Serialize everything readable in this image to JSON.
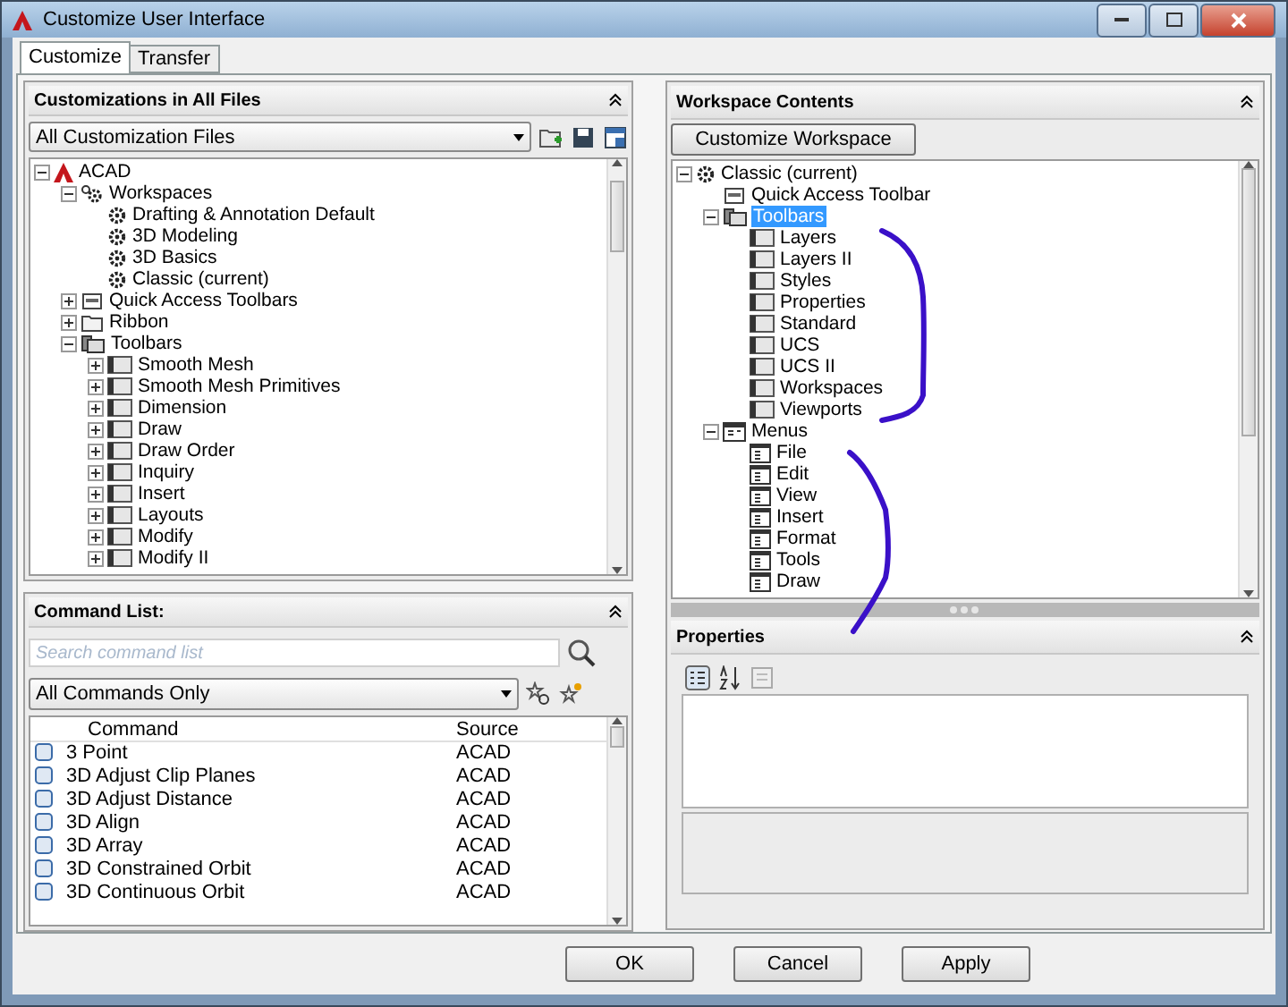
{
  "window": {
    "title": "Customize User Interface"
  },
  "tabs": [
    {
      "label": "Customize",
      "selected": true
    },
    {
      "label": "Transfer",
      "selected": false
    }
  ],
  "customizations": {
    "title": "Customizations in All Files",
    "file_filter": "All Customization Files",
    "tree": [
      {
        "label": "ACAD",
        "kind": "acad",
        "expanded": true,
        "selected": false,
        "children": [
          {
            "label": "Workspaces",
            "kind": "workspaces",
            "expanded": true,
            "selected": false,
            "children": [
              {
                "label": "Drafting & Annotation Default",
                "kind": "workspace",
                "selected": false
              },
              {
                "label": "3D Modeling",
                "kind": "workspace",
                "selected": false
              },
              {
                "label": "3D Basics",
                "kind": "workspace",
                "selected": false
              },
              {
                "label": "Classic (current)",
                "kind": "workspace",
                "selected": false
              }
            ]
          },
          {
            "label": "Quick Access Toolbars",
            "kind": "qat",
            "expanded": false,
            "selected": false
          },
          {
            "label": "Ribbon",
            "kind": "ribbon",
            "expanded": false,
            "selected": false
          },
          {
            "label": "Toolbars",
            "kind": "toolbars",
            "expanded": true,
            "selected": false,
            "children": [
              {
                "label": "Smooth Mesh",
                "kind": "toolbar",
                "expanded": false,
                "selected": false
              },
              {
                "label": "Smooth Mesh Primitives",
                "kind": "toolbar",
                "expanded": false,
                "selected": false
              },
              {
                "label": "Dimension",
                "kind": "toolbar",
                "expanded": false,
                "selected": false
              },
              {
                "label": "Draw",
                "kind": "toolbar",
                "expanded": false,
                "selected": false
              },
              {
                "label": "Draw Order",
                "kind": "toolbar",
                "expanded": false,
                "selected": false
              },
              {
                "label": "Inquiry",
                "kind": "toolbar",
                "expanded": false,
                "selected": false
              },
              {
                "label": "Insert",
                "kind": "toolbar",
                "expanded": false,
                "selected": false
              },
              {
                "label": "Layouts",
                "kind": "toolbar",
                "expanded": false,
                "selected": false
              },
              {
                "label": "Modify",
                "kind": "toolbar",
                "expanded": false,
                "selected": false
              },
              {
                "label": "Modify II",
                "kind": "toolbar",
                "expanded": false,
                "selected": false
              }
            ]
          }
        ]
      }
    ]
  },
  "command_list": {
    "title": "Command List:",
    "search": {
      "placeholder": "Search command list"
    },
    "filter": "All Commands Only",
    "columns": [
      "Command",
      "Source"
    ],
    "rows": [
      {
        "command": "3 Point",
        "source": "ACAD"
      },
      {
        "command": "3D Adjust Clip Planes",
        "source": "ACAD"
      },
      {
        "command": "3D Adjust Distance",
        "source": "ACAD"
      },
      {
        "command": "3D Align",
        "source": "ACAD"
      },
      {
        "command": "3D Array",
        "source": "ACAD"
      },
      {
        "command": "3D Constrained Orbit",
        "source": "ACAD"
      },
      {
        "command": "3D Continuous Orbit",
        "source": "ACAD"
      }
    ]
  },
  "workspace_contents": {
    "title": "Workspace Contents",
    "button": "Customize Workspace",
    "tree": [
      {
        "label": "Classic (current)",
        "kind": "workspace",
        "expanded": true,
        "selected": false,
        "children": [
          {
            "label": "Quick Access Toolbar",
            "kind": "qat",
            "selected": false
          },
          {
            "label": "Toolbars",
            "kind": "toolbars",
            "expanded": true,
            "selected": true,
            "children": [
              {
                "label": "Layers",
                "kind": "toolbar",
                "selected": false
              },
              {
                "label": "Layers II",
                "kind": "toolbar",
                "selected": false
              },
              {
                "label": "Styles",
                "kind": "toolbar",
                "selected": false
              },
              {
                "label": "Properties",
                "kind": "toolbar",
                "selected": false
              },
              {
                "label": "Standard",
                "kind": "toolbar",
                "selected": false
              },
              {
                "label": "UCS",
                "kind": "toolbar",
                "selected": false
              },
              {
                "label": "UCS II",
                "kind": "toolbar",
                "selected": false
              },
              {
                "label": "Workspaces",
                "kind": "toolbar",
                "selected": false
              },
              {
                "label": "Viewports",
                "kind": "toolbar",
                "selected": false
              }
            ]
          },
          {
            "label": "Menus",
            "kind": "menus",
            "expanded": true,
            "selected": false,
            "children": [
              {
                "label": "File",
                "kind": "menu",
                "selected": false
              },
              {
                "label": "Edit",
                "kind": "menu",
                "selected": false
              },
              {
                "label": "View",
                "kind": "menu",
                "selected": false
              },
              {
                "label": "Insert",
                "kind": "menu",
                "selected": false
              },
              {
                "label": "Format",
                "kind": "menu",
                "selected": false
              },
              {
                "label": "Tools",
                "kind": "menu",
                "selected": false
              },
              {
                "label": "Draw",
                "kind": "menu",
                "selected": false
              }
            ]
          }
        ]
      }
    ]
  },
  "properties": {
    "title": "Properties"
  },
  "buttons": [
    "OK",
    "Cancel",
    "Apply"
  ]
}
